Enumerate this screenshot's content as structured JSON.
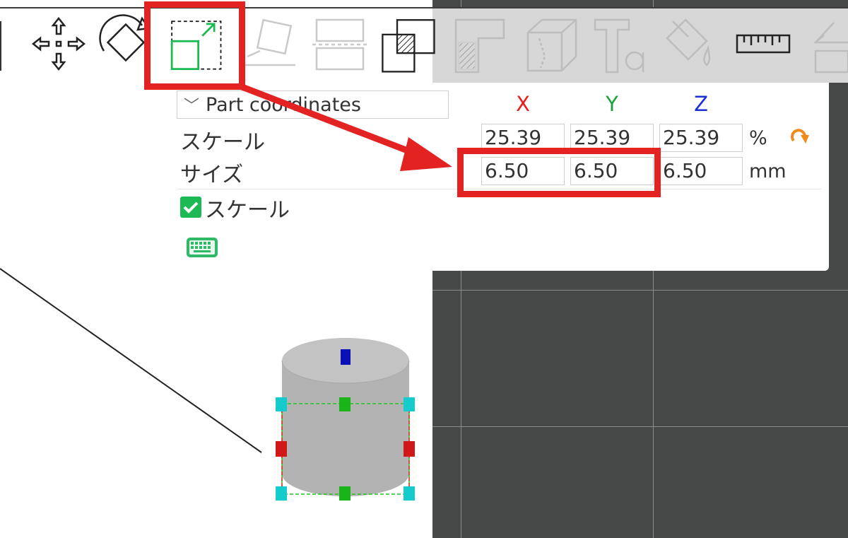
{
  "toolbar": {
    "tools": [
      {
        "name": "move",
        "icon": "move-icon"
      },
      {
        "name": "rotate",
        "icon": "rotate-icon"
      },
      {
        "name": "scale",
        "icon": "scale-icon",
        "active": true
      },
      {
        "name": "lay-on-face",
        "icon": "lay-on-face-icon"
      },
      {
        "name": "cut",
        "icon": "cut-icon"
      },
      {
        "name": "boolean",
        "icon": "boolean-icon"
      },
      {
        "name": "support-paint",
        "icon": "support-paint-icon"
      },
      {
        "name": "seam",
        "icon": "seam-icon"
      },
      {
        "name": "text",
        "icon": "text-icon"
      },
      {
        "name": "color-paint",
        "icon": "color-paint-icon"
      },
      {
        "name": "measure",
        "icon": "ruler-icon"
      },
      {
        "name": "assembly",
        "icon": "assembly-icon"
      }
    ]
  },
  "panel": {
    "coordinate_system": "Part coordinates",
    "axes": {
      "x": "X",
      "y": "Y",
      "z": "Z"
    },
    "axis_colors": {
      "x": "#e8201c",
      "y": "#1aa33c",
      "z": "#1a2fd8"
    },
    "scale": {
      "label": "スケール",
      "x": "25.39",
      "y": "25.39",
      "z": "25.39",
      "unit": "%"
    },
    "size": {
      "label": "サイズ",
      "x": "6.50",
      "y": "6.50",
      "z": "6.50",
      "unit": "mm"
    },
    "uniform_scale": {
      "label": "スケール",
      "checked": true
    }
  },
  "colors": {
    "annotation": "#e32222",
    "accent": "#1db954",
    "reset": "#f08a1c",
    "viewport": "#464948"
  }
}
